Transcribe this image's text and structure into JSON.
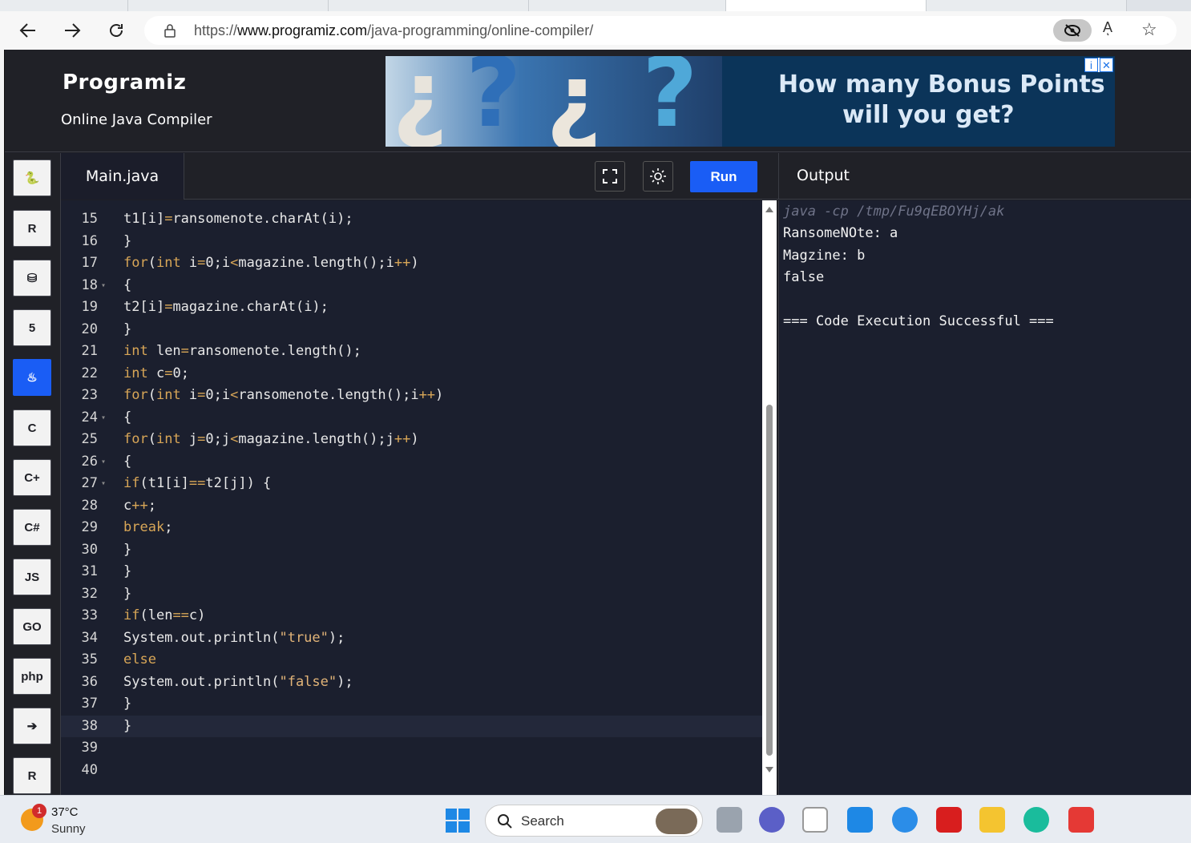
{
  "browser": {
    "url_prefix": "https://",
    "url_host": "www.programiz.com",
    "url_path": "/java-programming/online-compiler/",
    "read_aloud": "Aͅ"
  },
  "site": {
    "logo": "Programiz",
    "subtitle": "Online Java Compiler"
  },
  "ad": {
    "line1": "How many Bonus Points",
    "line2": "will you get?",
    "info": "i",
    "close": "✕"
  },
  "languages": [
    {
      "name": "python-lang",
      "label": "🐍"
    },
    {
      "name": "r-lang",
      "label": "R"
    },
    {
      "name": "sql-lang",
      "label": "⛁"
    },
    {
      "name": "html-lang",
      "label": "5"
    },
    {
      "name": "java-lang",
      "label": "♨"
    },
    {
      "name": "c-lang",
      "label": "C"
    },
    {
      "name": "cpp-lang",
      "label": "C+"
    },
    {
      "name": "csharp-lang",
      "label": "C#"
    },
    {
      "name": "js-lang",
      "label": "JS"
    },
    {
      "name": "go-lang",
      "label": "GO"
    },
    {
      "name": "php-lang",
      "label": "php"
    },
    {
      "name": "swift-lang",
      "label": "➔"
    },
    {
      "name": "rust-lang",
      "label": "R"
    }
  ],
  "editor": {
    "file_name": "Main.java",
    "run_label": "Run",
    "lines": [
      {
        "n": "15",
        "fold": "",
        "code": "t1[i]=ransomenote.charAt(i);"
      },
      {
        "n": "16",
        "fold": "",
        "code": "}"
      },
      {
        "n": "17",
        "fold": "",
        "code": "for(int i=0;i<magazine.length();i++)"
      },
      {
        "n": "18",
        "fold": "▾",
        "code": "{"
      },
      {
        "n": "19",
        "fold": "",
        "code": "t2[i]=magazine.charAt(i);"
      },
      {
        "n": "20",
        "fold": "",
        "code": "}"
      },
      {
        "n": "21",
        "fold": "",
        "code": "int len=ransomenote.length();"
      },
      {
        "n": "22",
        "fold": "",
        "code": "int c=0;"
      },
      {
        "n": "23",
        "fold": "",
        "code": "for(int i=0;i<ransomenote.length();i++)"
      },
      {
        "n": "24",
        "fold": "▾",
        "code": "{"
      },
      {
        "n": "25",
        "fold": "",
        "code": "for(int j=0;j<magazine.length();j++)"
      },
      {
        "n": "26",
        "fold": "▾",
        "code": "{"
      },
      {
        "n": "27",
        "fold": "▾",
        "code": "if(t1[i]==t2[j]) {"
      },
      {
        "n": "28",
        "fold": "",
        "code": "c++;"
      },
      {
        "n": "29",
        "fold": "",
        "code": "break;"
      },
      {
        "n": "30",
        "fold": "",
        "code": "}"
      },
      {
        "n": "31",
        "fold": "",
        "code": "}"
      },
      {
        "n": "32",
        "fold": "",
        "code": "}"
      },
      {
        "n": "33",
        "fold": "",
        "code": "if(len==c)"
      },
      {
        "n": "34",
        "fold": "",
        "code": "System.out.println(\"true\");"
      },
      {
        "n": "35",
        "fold": "",
        "code": "else"
      },
      {
        "n": "36",
        "fold": "",
        "code": "System.out.println(\"false\");"
      },
      {
        "n": "37",
        "fold": "",
        "code": "}"
      },
      {
        "n": "38",
        "fold": "",
        "code": "}"
      },
      {
        "n": "39",
        "fold": "",
        "code": ""
      },
      {
        "n": "40",
        "fold": "",
        "code": ""
      }
    ]
  },
  "output": {
    "title": "Output",
    "command": "java -cp /tmp/Fu9qEBOYHj/ak",
    "lines": [
      "RansomeNOte: a",
      "Magzine: b",
      "false",
      "",
      "=== Code Execution Successful ==="
    ]
  },
  "taskbar": {
    "weather_badge": "1",
    "temperature": "37°C",
    "condition": "Sunny",
    "search_placeholder": "Search"
  }
}
